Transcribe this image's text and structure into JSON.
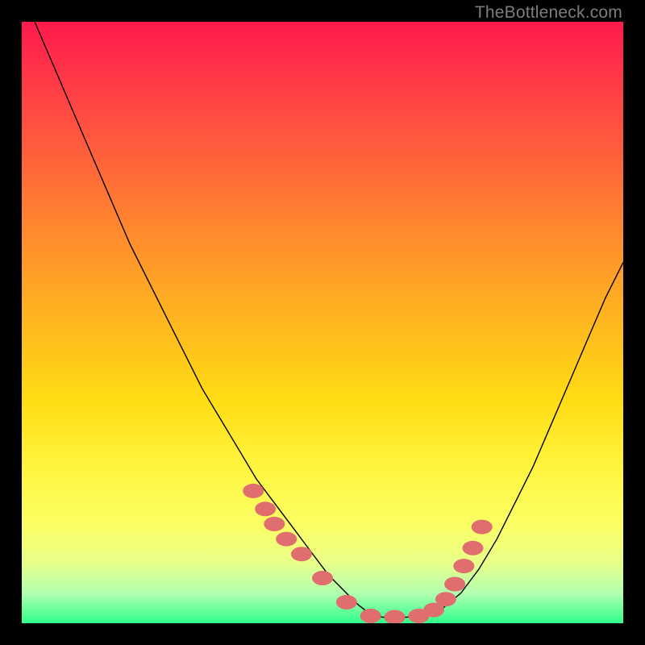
{
  "watermark": "TheBottleneck.com",
  "colors": {
    "background": "#000000",
    "marker": "#e06e6e",
    "curve": "#000000",
    "gradient_top": "#ff1a4d",
    "gradient_bottom": "#2eff8a"
  },
  "chart_data": {
    "type": "line",
    "title": "",
    "xlabel": "",
    "ylabel": "",
    "xlim": [
      0,
      100
    ],
    "ylim": [
      0,
      100
    ],
    "x": [
      0,
      3,
      6,
      9,
      12,
      15,
      18,
      21,
      24,
      27,
      30,
      33,
      36,
      39,
      42,
      45,
      48,
      51,
      54,
      56,
      58,
      60,
      62,
      64,
      67,
      70,
      73,
      76,
      79,
      82,
      85,
      88,
      91,
      94,
      97,
      100
    ],
    "y": [
      105,
      98,
      91,
      84,
      77,
      70,
      63,
      57,
      51,
      45,
      39,
      34,
      29,
      24,
      20,
      16,
      12,
      8,
      5,
      3,
      1.5,
      1,
      1,
      1,
      1.3,
      2.5,
      5,
      9,
      14,
      20,
      26,
      33,
      40,
      47,
      54,
      60
    ],
    "marker_points_x": [
      38.5,
      40.5,
      42,
      44,
      46.5,
      50,
      54,
      58,
      62,
      66,
      68.5,
      70.5,
      72,
      73.5,
      75,
      76.5
    ],
    "marker_points_y": [
      22,
      19,
      16.5,
      14,
      11.5,
      7.5,
      3.5,
      1.2,
      1,
      1.2,
      2.2,
      4,
      6.5,
      9.5,
      12.5,
      16
    ]
  }
}
